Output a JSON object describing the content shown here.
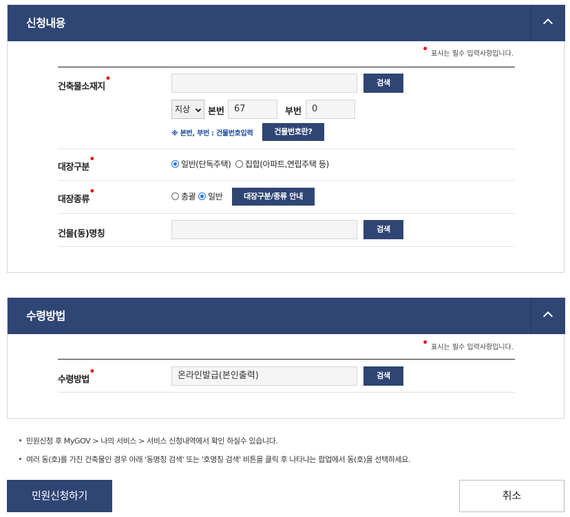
{
  "section1": {
    "title": "신청내용",
    "required_note": "표시는 필수 입력사항입니다.",
    "address": {
      "label": "건축물소재지",
      "value": "",
      "search_label": "검색",
      "floor_select": "지상",
      "main_no_label": "본번",
      "main_no_value": "67",
      "sub_no_label": "부번",
      "sub_no_value": "0",
      "hint": "※ 본번, 부번 : 건물번호입력",
      "building_no_button": "건물번호란?"
    },
    "register_type": {
      "label": "대장구분",
      "options": [
        "일반(단독주택)",
        "집합(아파트,연립주택 등)"
      ],
      "selected": "일반(단독주택)"
    },
    "register_kind": {
      "label": "대장종류",
      "options": [
        "총괄",
        "일반"
      ],
      "selected": "일반",
      "guide_button": "대장구분/종류 안내"
    },
    "building_name": {
      "label": "건물(동)명칭",
      "value": "",
      "search_label": "검색"
    }
  },
  "section2": {
    "title": "수령방법",
    "required_note": "표시는 필수 입력사항입니다.",
    "receive": {
      "label": "수령방법",
      "value": "온라인발급(본인출력)",
      "search_label": "검색"
    }
  },
  "notices": [
    "민원신청 후 MyGOV > 나의 서비스 > 서비스 신청내역에서 확인 하실수 있습니다.",
    "여러 동(호)를 가진 건축물인 경우 아래 '동명칭 검색' 또는 '호명칭 검색' 비튼을 클릭 후 나타나는 팝업에서 동(호)을 선택하세요."
  ],
  "actions": {
    "submit_label": "민원신청하기",
    "cancel_label": "취소"
  },
  "colors": {
    "header_navy": "#2f4574",
    "required_red": "#e01a1a",
    "hint_blue": "#1c4a9c"
  },
  "icons": {
    "collapse": "chevron-up-icon"
  }
}
